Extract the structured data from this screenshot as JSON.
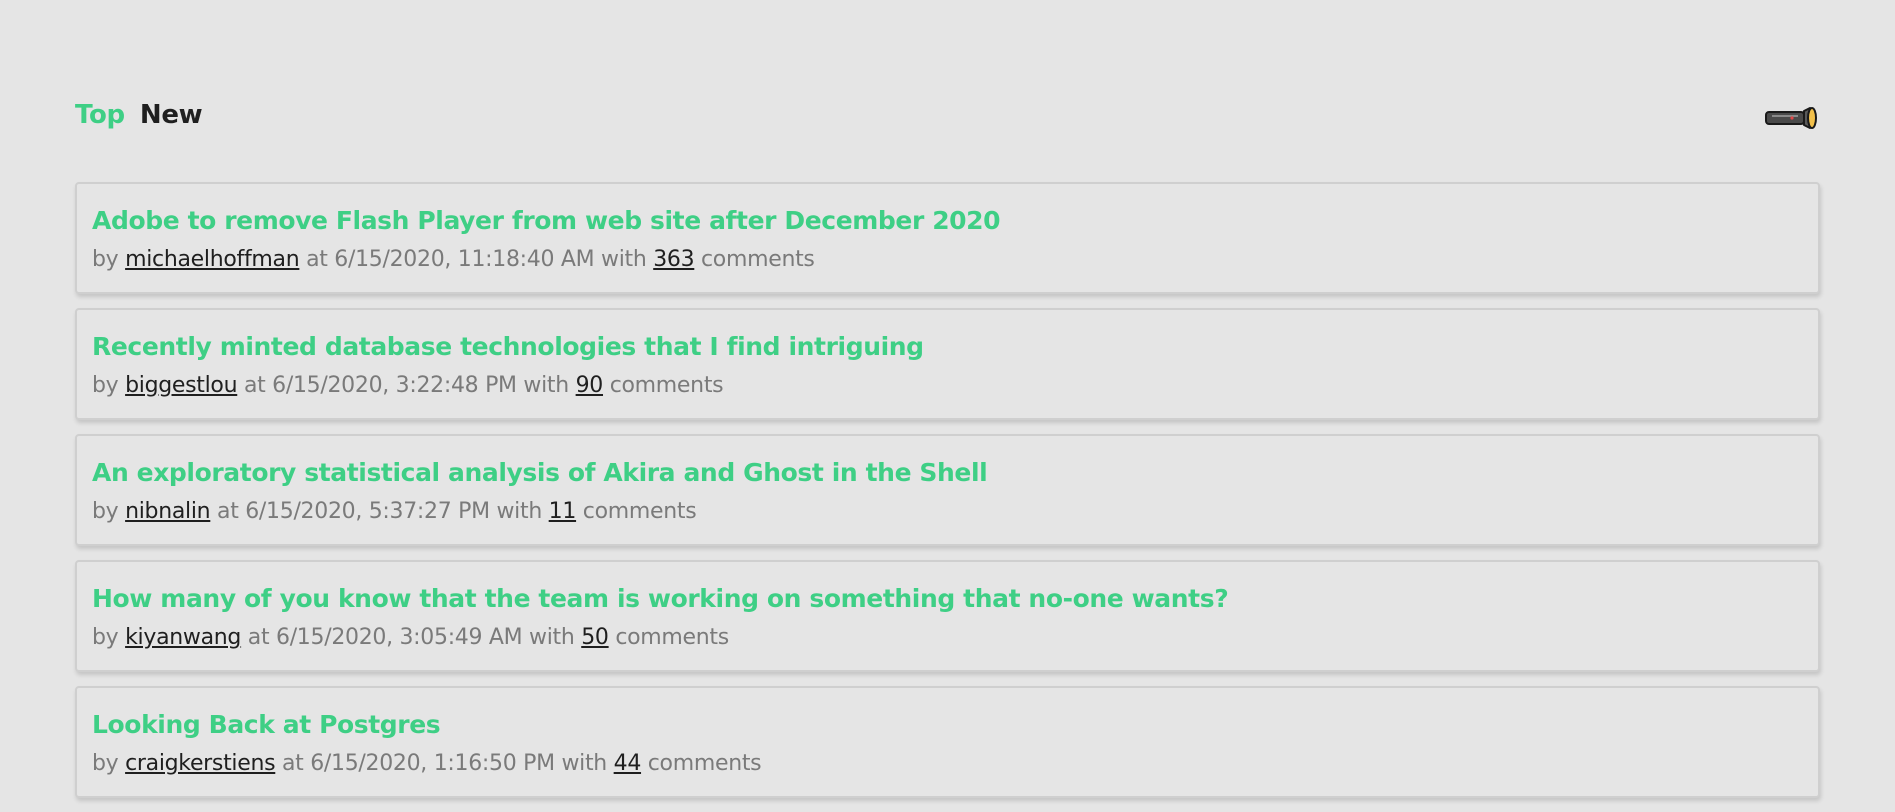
{
  "nav": {
    "top_label": "Top",
    "new_label": "New",
    "theme_toggle_icon": "flashlight-icon"
  },
  "colors": {
    "accent": "#3ecf85",
    "background": "#e5e5e5",
    "meta_text": "#7a7a7a",
    "link_text": "#1f1f1f"
  },
  "meta_words": {
    "by": "by",
    "at": "at",
    "with": "with",
    "comments": "comments"
  },
  "stories": [
    {
      "title": "Adobe to remove Flash Player from web site after December 2020",
      "author": "michaelhoffman",
      "time": "6/15/2020, 11:18:40 AM",
      "comments": "363"
    },
    {
      "title": "Recently minted database technologies that I find intriguing",
      "author": "biggestlou",
      "time": "6/15/2020, 3:22:48 PM",
      "comments": "90"
    },
    {
      "title": "An exploratory statistical analysis of Akira and Ghost in the Shell",
      "author": "nibnalin",
      "time": "6/15/2020, 5:37:27 PM",
      "comments": "11"
    },
    {
      "title": "How many of you know that the team is working on something that no-one wants?",
      "author": "kiyanwang",
      "time": "6/15/2020, 3:05:49 AM",
      "comments": "50"
    },
    {
      "title": "Looking Back at Postgres",
      "author": "craigkerstiens",
      "time": "6/15/2020, 1:16:50 PM",
      "comments": "44"
    }
  ]
}
